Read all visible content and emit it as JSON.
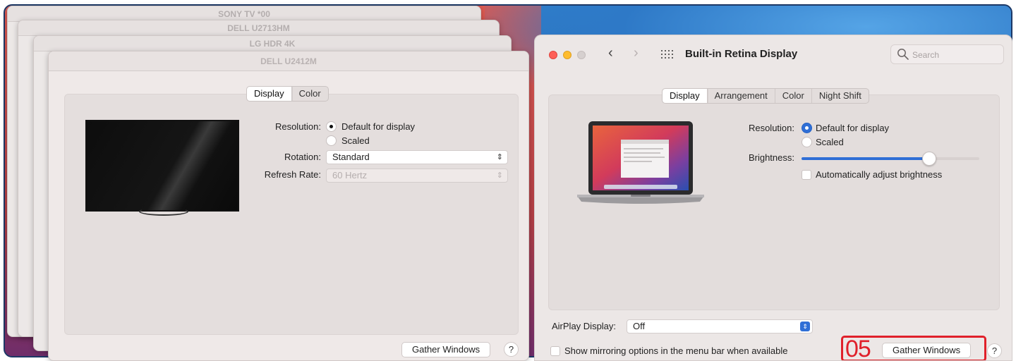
{
  "background_windows": [
    {
      "title": "SONY TV  *00"
    },
    {
      "title": "DELL U2713HM"
    },
    {
      "title": "LG HDR 4K"
    }
  ],
  "external_display": {
    "title": "DELL U2412M",
    "tabs": [
      "Display",
      "Color"
    ],
    "active_tab": "Display",
    "resolution_label": "Resolution:",
    "resolution_options": [
      "Default for display",
      "Scaled"
    ],
    "rotation_label": "Rotation:",
    "rotation_value": "Standard",
    "refresh_label": "Refresh Rate:",
    "refresh_value": "60 Hertz",
    "gather_label": "Gather Windows",
    "help_label": "?"
  },
  "main_window": {
    "title": "Built-in Retina Display",
    "search_placeholder": "Search",
    "tabs": [
      "Display",
      "Arrangement",
      "Color",
      "Night Shift"
    ],
    "active_tab": "Display",
    "resolution_label": "Resolution:",
    "resolution_options": [
      "Default for display",
      "Scaled"
    ],
    "brightness_label": "Brightness:",
    "brightness_level": 0.72,
    "auto_brightness_label": "Automatically adjust brightness",
    "airplay_label": "AirPlay Display:",
    "airplay_value": "Off",
    "mirroring_label": "Show mirroring options in the menu bar when available",
    "gather_label": "Gather Windows",
    "help_label": "?"
  },
  "annotation": {
    "step": "05",
    "color": "#e0202a"
  },
  "colors": {
    "accent": "#2f6fd6",
    "close": "#fe5f57",
    "minimize": "#febc2e"
  }
}
